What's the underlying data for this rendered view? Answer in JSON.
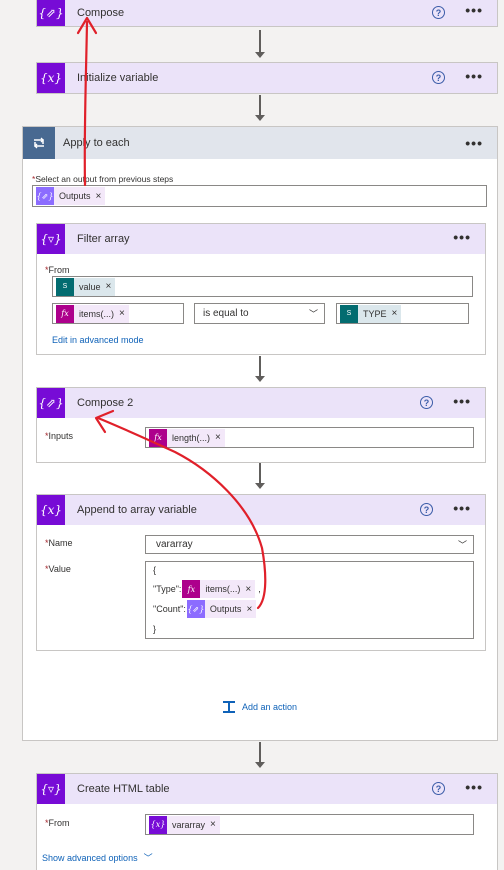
{
  "compose": {
    "title": "Compose",
    "icon": "compose-icon"
  },
  "init_var": {
    "title": "Initialize variable",
    "icon": "variable-icon"
  },
  "apply": {
    "title": "Apply to each",
    "icon": "loop-icon",
    "select_label": "Select an output from previous steps",
    "outputs_token": "Outputs"
  },
  "filter": {
    "title": "Filter array",
    "from_label": "From",
    "value_token": "value",
    "left_token": "items(...)",
    "operator": "is equal to",
    "right_token": "TYPE",
    "advanced_link": "Edit in advanced mode"
  },
  "compose2": {
    "title": "Compose 2",
    "inputs_label": "Inputs",
    "length_token": "length(...)"
  },
  "append": {
    "title": "Append to array variable",
    "name_label": "Name",
    "name_value": "vararray",
    "value_label": "Value",
    "open_brace": "{",
    "type_key": "\"Type\":",
    "type_token": "items(...)",
    "comma": ",",
    "count_key": "\"Count\":",
    "count_token": "Outputs",
    "close_brace": "}"
  },
  "add_action": "Add an action",
  "html_table": {
    "title": "Create HTML table",
    "from_label": "From",
    "from_token": "vararray",
    "advanced_options": "Show advanced options"
  },
  "glyphs": {
    "help": "?",
    "more": "•••",
    "remove": "×",
    "chevron": "﹀",
    "required": "*",
    "fx": "fx",
    "var": "{x}",
    "compose": "{⇗}",
    "filter": "{▿}",
    "sp": "S"
  },
  "colors": {
    "action_purple": "#770bd6",
    "loop_slate": "#486991",
    "expression_pink": "#ad008c",
    "annotation_red": "#e0202a",
    "link_blue": "#0f62b8"
  }
}
